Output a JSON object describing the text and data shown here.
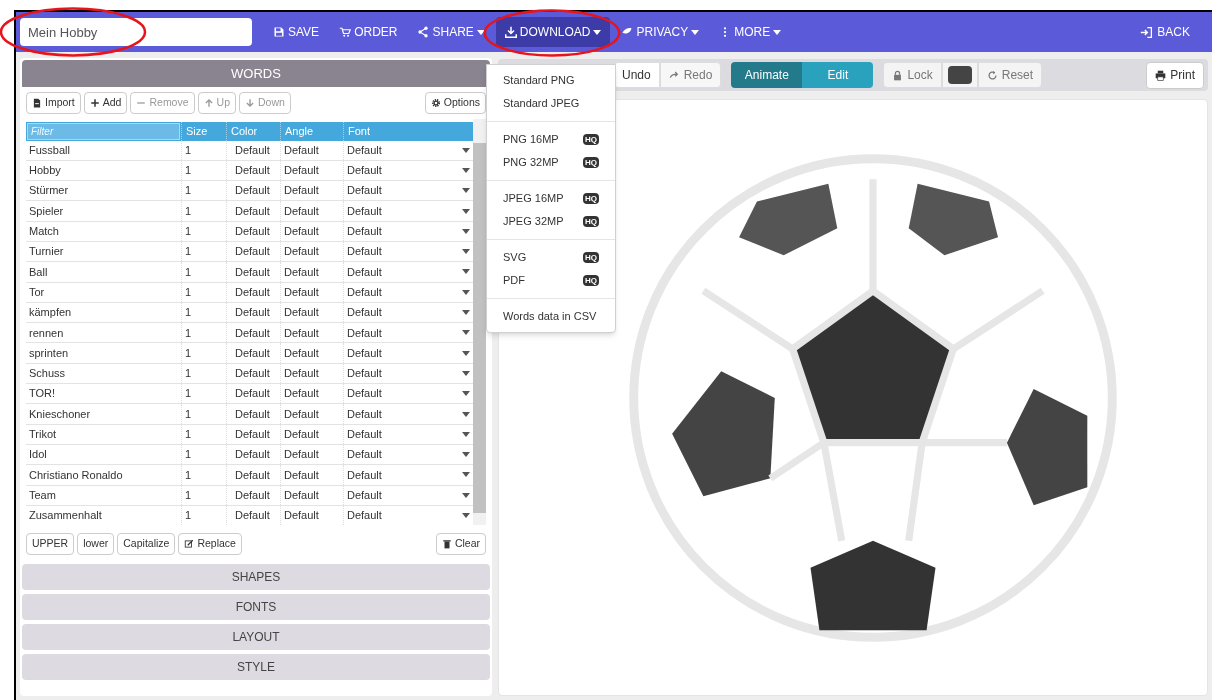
{
  "title_field": {
    "value": "Mein Hobby",
    "highlighted": true
  },
  "nav": [
    {
      "label": "SAVE",
      "dropdown": false,
      "selected": false,
      "highlighted": false
    },
    {
      "label": "ORDER",
      "dropdown": false,
      "selected": false,
      "highlighted": false
    },
    {
      "label": "SHARE",
      "dropdown": true,
      "selected": false,
      "highlighted": false
    },
    {
      "label": "DOWNLOAD",
      "dropdown": true,
      "selected": true,
      "highlighted": true
    },
    {
      "label": "PRIVACY",
      "dropdown": true,
      "selected": false,
      "highlighted": false
    },
    {
      "label": "MORE",
      "dropdown": true,
      "selected": false,
      "highlighted": false
    }
  ],
  "back_button": {
    "label": "BACK"
  },
  "words_panel": {
    "title": "WORDS",
    "toolbar": [
      {
        "label": "Import",
        "disabled": false
      },
      {
        "label": "Add",
        "disabled": false
      },
      {
        "label": "Remove",
        "disabled": true
      },
      {
        "label": "Up",
        "disabled": true
      },
      {
        "label": "Down",
        "disabled": true
      }
    ],
    "options_button": "Options",
    "columns": [
      {
        "kind": "filter",
        "placeholder": "Filter"
      },
      {
        "kind": "label",
        "label": "Size"
      },
      {
        "kind": "label",
        "label": "Color"
      },
      {
        "kind": "label",
        "label": "Angle"
      },
      {
        "kind": "label",
        "label": "Font"
      }
    ],
    "rows": [
      [
        "Fussball",
        "1",
        "Default",
        "Default",
        "Default"
      ],
      [
        "Hobby",
        "1",
        "Default",
        "Default",
        "Default"
      ],
      [
        "Stürmer",
        "1",
        "Default",
        "Default",
        "Default"
      ],
      [
        "Spieler",
        "1",
        "Default",
        "Default",
        "Default"
      ],
      [
        "Match",
        "1",
        "Default",
        "Default",
        "Default"
      ],
      [
        "Turnier",
        "1",
        "Default",
        "Default",
        "Default"
      ],
      [
        "Ball",
        "1",
        "Default",
        "Default",
        "Default"
      ],
      [
        "Tor",
        "1",
        "Default",
        "Default",
        "Default"
      ],
      [
        "kämpfen",
        "1",
        "Default",
        "Default",
        "Default"
      ],
      [
        "rennen",
        "1",
        "Default",
        "Default",
        "Default"
      ],
      [
        "sprinten",
        "1",
        "Default",
        "Default",
        "Default"
      ],
      [
        "Schuss",
        "1",
        "Default",
        "Default",
        "Default"
      ],
      [
        "TOR!",
        "1",
        "Default",
        "Default",
        "Default"
      ],
      [
        "Knieschoner",
        "1",
        "Default",
        "Default",
        "Default"
      ],
      [
        "Trikot",
        "1",
        "Default",
        "Default",
        "Default"
      ],
      [
        "Idol",
        "1",
        "Default",
        "Default",
        "Default"
      ],
      [
        "Christiano Ronaldo",
        "1",
        "Default",
        "Default",
        "Default"
      ],
      [
        "Team",
        "1",
        "Default",
        "Default",
        "Default"
      ],
      [
        "Zusammenhalt",
        "1",
        "Default",
        "Default",
        "Default"
      ]
    ],
    "case_buttons": [
      "UPPER",
      "lower",
      "Capitalize"
    ],
    "replace_button": "Replace",
    "clear_button": "Clear"
  },
  "sections": [
    "SHAPES",
    "FONTS",
    "LAYOUT",
    "STYLE"
  ],
  "canvas_toolbar": {
    "undo": "Undo",
    "redo": "Redo",
    "modes": [
      {
        "label": "Animate",
        "selected": true
      },
      {
        "label": "Edit",
        "selected": false
      }
    ],
    "lock": "Lock",
    "reset": "Reset",
    "print": "Print"
  },
  "download_menu": [
    [
      {
        "label": "Standard PNG"
      },
      {
        "label": "Standard JPEG"
      }
    ],
    [
      {
        "label": "PNG 16MP",
        "badge": "HQ"
      },
      {
        "label": "PNG 32MP",
        "badge": "HQ"
      }
    ],
    [
      {
        "label": "JPEG 16MP",
        "badge": "HQ"
      },
      {
        "label": "JPEG 32MP",
        "badge": "HQ"
      }
    ],
    [
      {
        "label": "SVG",
        "badge": "HQ"
      },
      {
        "label": "PDF",
        "badge": "HQ"
      }
    ],
    [
      {
        "label": "Words data in CSV"
      }
    ]
  ]
}
